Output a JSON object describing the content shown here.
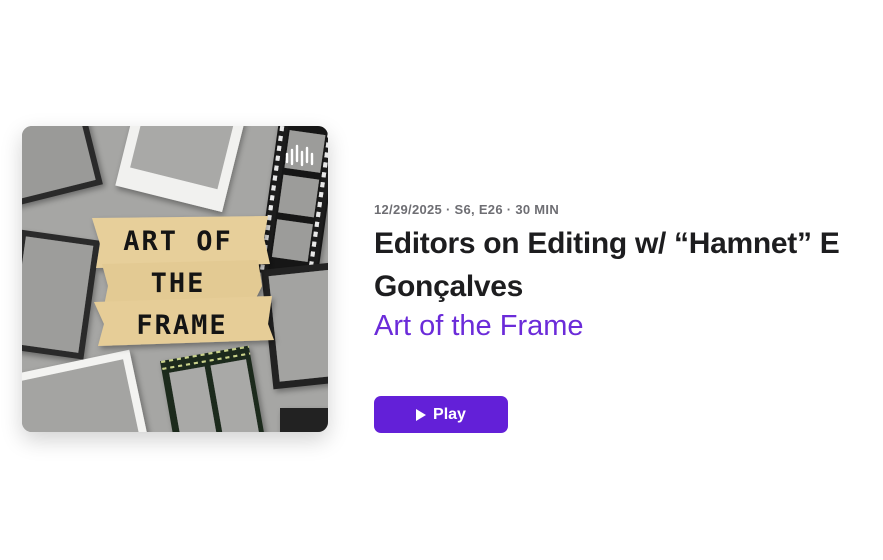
{
  "episode": {
    "meta": "12/29/2025 · S6, E26 · 30 MIN",
    "title_line1": "Editors on Editing w/ “Hamnet” E",
    "title_line2": "Gonçalves",
    "show_name": "Art of the Frame"
  },
  "artwork": {
    "lines": [
      "ART OF",
      "THE",
      "FRAME"
    ],
    "badge_icon": "podcast-waveform-icon"
  },
  "play_button": {
    "label": "Play",
    "icon": "play-icon"
  },
  "colors": {
    "accent": "#6320d8",
    "show_link": "#6b2bd9",
    "title": "#1d1d1f",
    "meta": "#6e6e73"
  }
}
